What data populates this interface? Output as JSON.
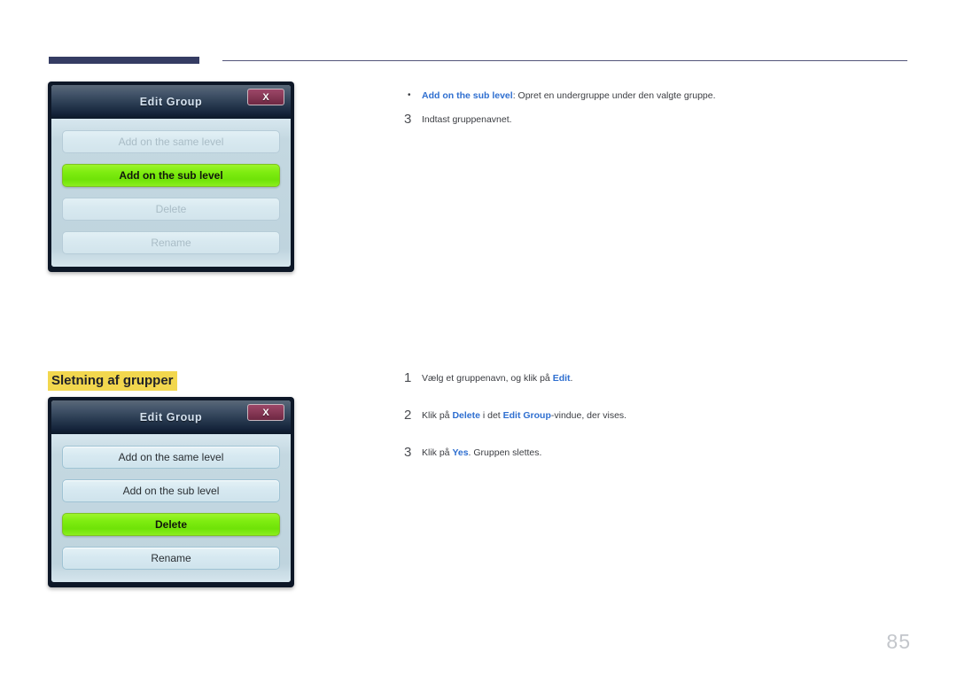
{
  "page": {
    "number": "85",
    "section_heading": "Sletning af grupper"
  },
  "dialog_top": {
    "title": "Edit Group",
    "close_label": "X",
    "buttons": [
      {
        "label": "Add on the same level",
        "state": "disabled"
      },
      {
        "label": "Add on the sub level",
        "state": "selected"
      },
      {
        "label": "Delete",
        "state": "disabled"
      },
      {
        "label": "Rename",
        "state": "disabled"
      }
    ]
  },
  "dialog_bottom": {
    "title": "Edit Group",
    "close_label": "X",
    "buttons": [
      {
        "label": "Add on the same level",
        "state": "normal"
      },
      {
        "label": "Add on the sub level",
        "state": "normal"
      },
      {
        "label": "Delete",
        "state": "selected"
      },
      {
        "label": "Rename",
        "state": "normal"
      }
    ]
  },
  "top_text": {
    "bullet_marker": "•",
    "bullet_term": "Add on the sub level",
    "bullet_rest": ": Opret en undergruppe under den valgte gruppe.",
    "step_number": "3",
    "step_text": "Indtast gruppenavnet."
  },
  "delete_steps": [
    {
      "number": "1",
      "parts": [
        {
          "text": "Vælg et gruppenavn, og klik på ",
          "style": "plain"
        },
        {
          "text": "Edit",
          "style": "blue"
        },
        {
          "text": ".",
          "style": "plain"
        }
      ]
    },
    {
      "number": "2",
      "parts": [
        {
          "text": "Klik på ",
          "style": "plain"
        },
        {
          "text": "Delete",
          "style": "blue"
        },
        {
          "text": " i det ",
          "style": "plain"
        },
        {
          "text": "Edit Group",
          "style": "blue"
        },
        {
          "text": "-vindue, der vises.",
          "style": "plain"
        }
      ]
    },
    {
      "number": "3",
      "parts": [
        {
          "text": "Klik på ",
          "style": "plain"
        },
        {
          "text": "Yes",
          "style": "blue"
        },
        {
          "text": ". Gruppen slettes.",
          "style": "plain"
        }
      ]
    }
  ],
  "colors": {
    "rule_dark": "#353c63",
    "heading_highlight": "#f2d74e",
    "link_blue": "#2f6fd0",
    "selected_green": "#7eec10",
    "close_maroon": "#8b3b59"
  }
}
